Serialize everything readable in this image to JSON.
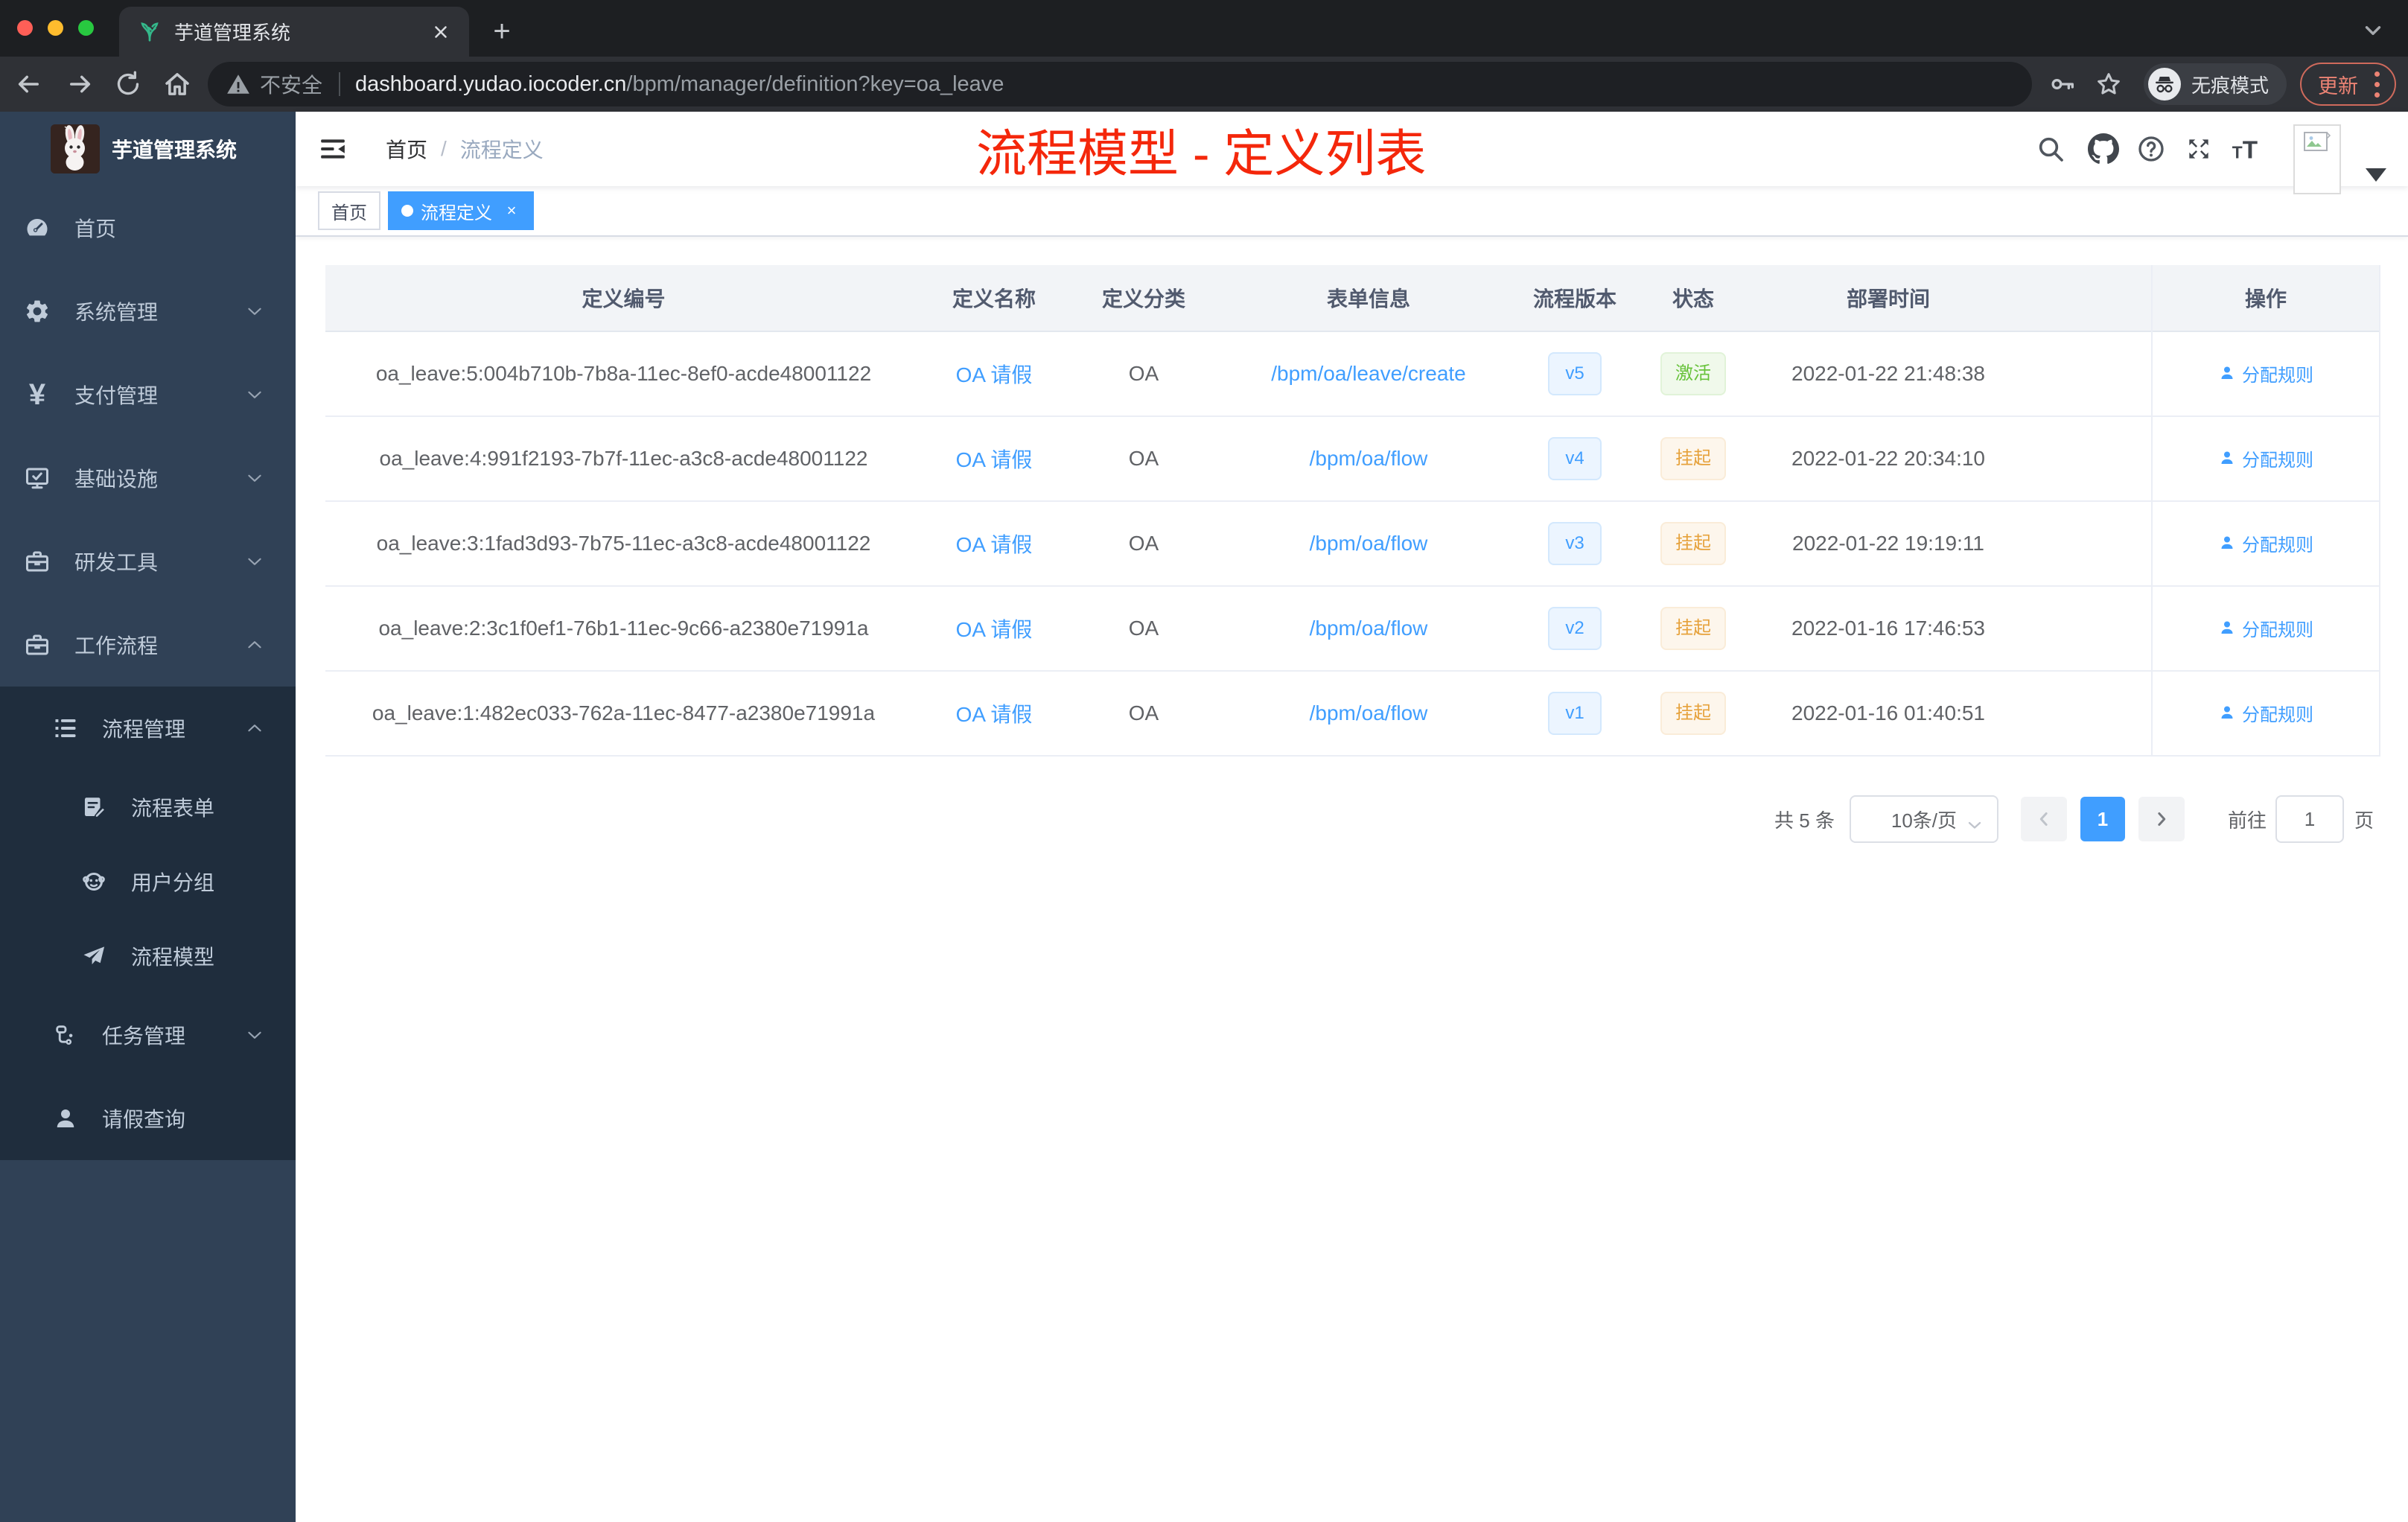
{
  "browser": {
    "tab_title": "芋道管理系统",
    "new_tab": "+",
    "close_tab": "×",
    "security_label": "不安全",
    "url_host": "dashboard.yudao.iocoder.cn",
    "url_path": "/bpm/manager/definition?key=oa_leave",
    "incognito_label": "无痕模式",
    "update_label": "更新"
  },
  "sidebar": {
    "logo_title": "芋道管理系统",
    "items": [
      {
        "label": "首页",
        "icon": "dashboard-icon",
        "level": 1,
        "arrow": ""
      },
      {
        "label": "系统管理",
        "icon": "gear-icon",
        "level": 1,
        "arrow": "down"
      },
      {
        "label": "支付管理",
        "icon": "yen-icon",
        "level": 1,
        "arrow": "down"
      },
      {
        "label": "基础设施",
        "icon": "monitor-check-icon",
        "level": 1,
        "arrow": "down"
      },
      {
        "label": "研发工具",
        "icon": "toolbox-icon",
        "level": 1,
        "arrow": "down"
      },
      {
        "label": "工作流程",
        "icon": "briefcase-icon",
        "level": 1,
        "arrow": "up"
      },
      {
        "label": "流程管理",
        "icon": "tree-list-icon",
        "level": 2,
        "arrow": "up"
      },
      {
        "label": "流程表单",
        "icon": "form-edit-icon",
        "level": 3,
        "arrow": ""
      },
      {
        "label": "用户分组",
        "icon": "people-icon",
        "level": 3,
        "arrow": ""
      },
      {
        "label": "流程模型",
        "icon": "send-icon",
        "level": 3,
        "arrow": ""
      },
      {
        "label": "任务管理",
        "icon": "flow-icon",
        "level": 2,
        "arrow": "down"
      },
      {
        "label": "请假查询",
        "icon": "person-icon",
        "level": 2,
        "arrow": ""
      }
    ]
  },
  "navbar": {
    "breadcrumb_home": "首页",
    "breadcrumb_sep": "/",
    "breadcrumb_current": "流程定义",
    "annotation": "流程模型 - 定义列表"
  },
  "tags": {
    "home": "首页",
    "current": "流程定义",
    "close": "×"
  },
  "table": {
    "headers": [
      "定义编号",
      "定义名称",
      "定义分类",
      "表单信息",
      "流程版本",
      "状态",
      "部署时间",
      "操作"
    ],
    "action_label": "分配规则",
    "rows": [
      {
        "id": "oa_leave:5:004b710b-7b8a-11ec-8ef0-acde48001122",
        "name": "OA 请假",
        "category": "OA",
        "form": "/bpm/oa/leave/create",
        "version": "v5",
        "status": "激活",
        "status_type": "success",
        "time": "2022-01-22 21:48:38",
        "action": "分配规则"
      },
      {
        "id": "oa_leave:4:991f2193-7b7f-11ec-a3c8-acde48001122",
        "name": "OA 请假",
        "category": "OA",
        "form": "/bpm/oa/flow",
        "version": "v4",
        "status": "挂起",
        "status_type": "warning",
        "time": "2022-01-22 20:34:10",
        "action": "分配规则"
      },
      {
        "id": "oa_leave:3:1fad3d93-7b75-11ec-a3c8-acde48001122",
        "name": "OA 请假",
        "category": "OA",
        "form": "/bpm/oa/flow",
        "version": "v3",
        "status": "挂起",
        "status_type": "warning",
        "time": "2022-01-22 19:19:11",
        "action": "分配规则"
      },
      {
        "id": "oa_leave:2:3c1f0ef1-76b1-11ec-9c66-a2380e71991a",
        "name": "OA 请假",
        "category": "OA",
        "form": "/bpm/oa/flow",
        "version": "v2",
        "status": "挂起",
        "status_type": "warning",
        "time": "2022-01-16 17:46:53",
        "action": "分配规则"
      },
      {
        "id": "oa_leave:1:482ec033-762a-11ec-8477-a2380e71991a",
        "name": "OA 请假",
        "category": "OA",
        "form": "/bpm/oa/flow",
        "version": "v1",
        "status": "挂起",
        "status_type": "warning",
        "time": "2022-01-16 01:40:51",
        "action": "分配规则"
      }
    ]
  },
  "pagination": {
    "total": "共 5 条",
    "page_size": "10条/页",
    "current_page": "1",
    "goto_label": "前往",
    "goto_value": "1",
    "page_unit": "页"
  },
  "colors": {
    "accent_blue": "#409eff",
    "success_green": "#67c23a",
    "warning_orange": "#e6a23c",
    "sidebar_bg": "#304156",
    "submenu_bg": "#1f2d3d",
    "annotation_red": "#f4270b",
    "update_salmon": "#ec8374"
  }
}
